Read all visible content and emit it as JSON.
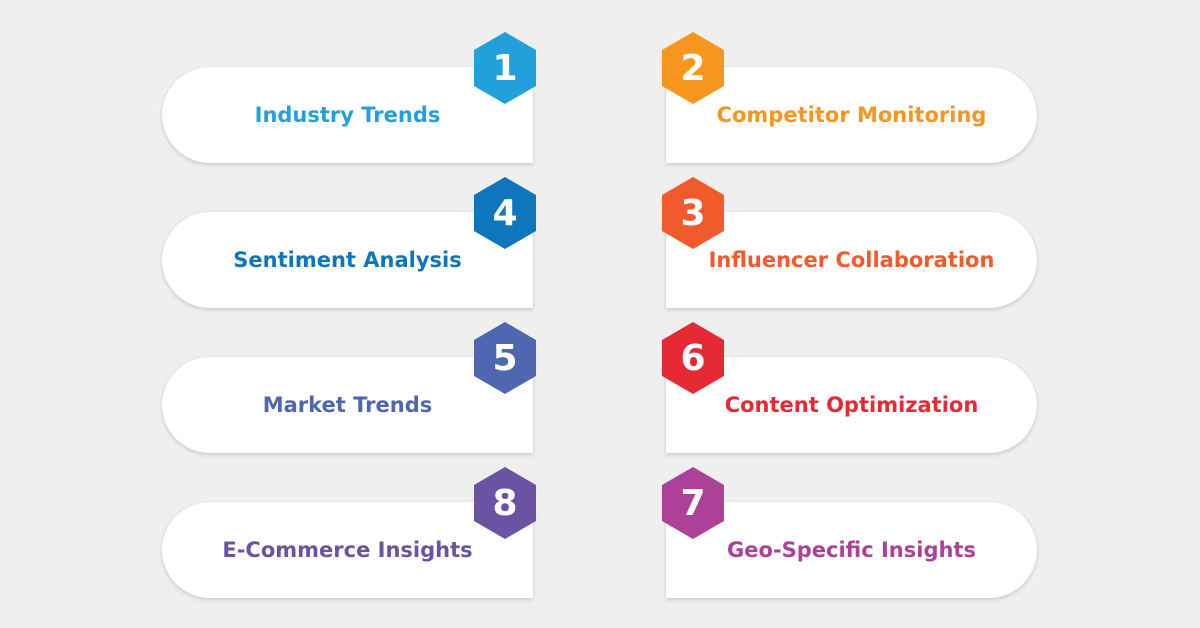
{
  "items": [
    {
      "number": "1",
      "label": "Industry Trends",
      "color": "#21a0dc"
    },
    {
      "number": "2",
      "label": "Competitor Monitoring",
      "color": "#f7961f"
    },
    {
      "number": "4",
      "label": "Sentiment Analysis",
      "color": "#0f75bc"
    },
    {
      "number": "3",
      "label": "Influencer Collaboration",
      "color": "#f15a2b"
    },
    {
      "number": "5",
      "label": "Market Trends",
      "color": "#4f67b0"
    },
    {
      "number": "6",
      "label": "Content Optimization",
      "color": "#e62a35"
    },
    {
      "number": "8",
      "label": "E-Commerce Insights",
      "color": "#6a53a2"
    },
    {
      "number": "7",
      "label": "Geo-Specific Insights",
      "color": "#ad4197"
    }
  ]
}
